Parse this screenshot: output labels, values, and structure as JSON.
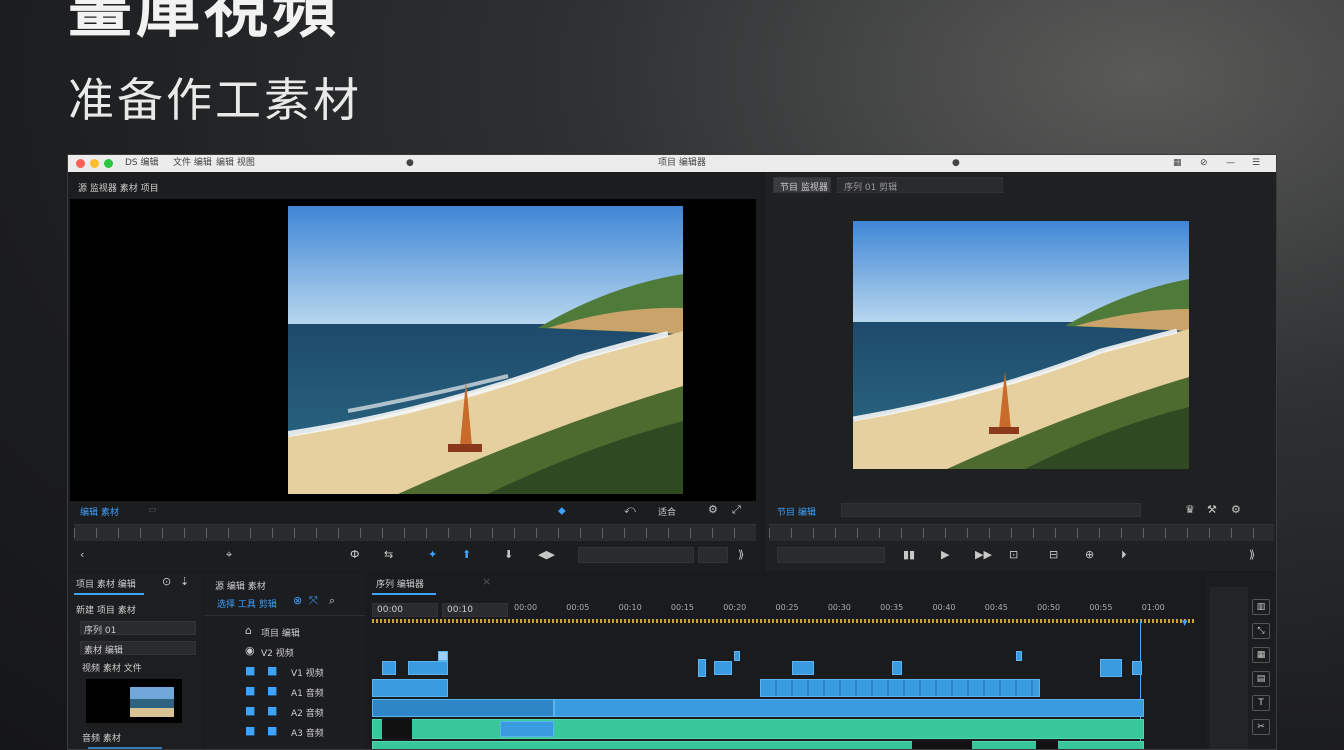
{
  "hero": {
    "title": "畫庫視頻",
    "subtitle": "准备作工素材"
  },
  "window": {
    "menu_left": "DS 编辑",
    "menu_mid": "文件 编辑",
    "menu_mid2": "编辑 视图",
    "title": "项目 编辑器",
    "dot_left": "●",
    "dot_right": "●"
  },
  "source_panel": {
    "label": "源 监视器 素材 项目",
    "timecode_left": "编辑 素材",
    "timecode_right": "适合",
    "tools": [
      "⌖",
      "Ф",
      "⇆",
      "✦",
      "⬆",
      "⬇",
      "◀▶",
      "⟪",
      "⟫"
    ]
  },
  "program_panel": {
    "tab_label": "节目 监视器",
    "field_label": "序列 01 剪辑",
    "timecode": "节目 编辑",
    "tools": [
      "▮▮",
      "▶",
      "▶▶",
      "⊡",
      "⊟",
      "⊕",
      "⏵"
    ]
  },
  "project_panel": {
    "tab": "项目 素材 编辑",
    "header": "新建 项目 素材",
    "item1": "序列 01",
    "item2": "素材 编辑",
    "item3": "视频 素材 文件",
    "item4": "音频 素材"
  },
  "tools_panel": {
    "label": "源 编辑 素材",
    "sub": "选择 工具 剪辑",
    "rows": [
      "项目 编辑",
      "V2 视频",
      "V1 视频",
      "A1 音频",
      "A2 音频",
      "A3 音频"
    ]
  },
  "timeline": {
    "tab": "序列 编辑器",
    "timecode_start": "00:00",
    "timecode_mid": "00:10",
    "ruler_labels": [
      "00:00",
      "00:05",
      "00:10",
      "00:15",
      "00:20",
      "00:25",
      "00:30",
      "00:35",
      "00:40",
      "00:45",
      "00:50",
      "00:55",
      "01:00"
    ]
  },
  "colors": {
    "accent": "#3ea2ff",
    "clip_blue": "#3a9be0",
    "clip_green": "#38c79a"
  }
}
